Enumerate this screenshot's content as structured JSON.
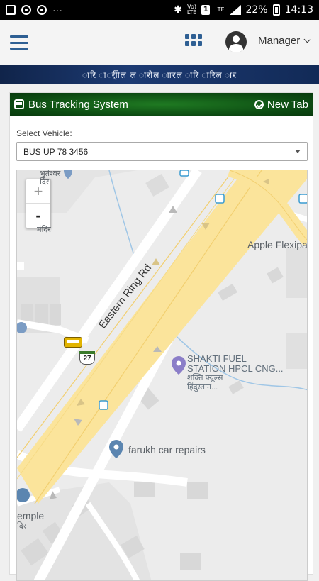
{
  "statusbar": {
    "icons_left": [
      "image-icon",
      "media-icon",
      "media-icon",
      "more-dots"
    ],
    "dots": "···",
    "network_top": "Vo)",
    "network_bottom": "LTE",
    "sim": "1",
    "lte2": "LTE",
    "battery": "22%",
    "time": "14:13"
  },
  "header": {
    "user_label": "Manager"
  },
  "banner": {
    "text": "ारि ार्ीोल ल ारोल ाारल ारि   ारिल ार"
  },
  "panel": {
    "title": "Bus Tracking System",
    "new_tab": "New Tab"
  },
  "vehicle": {
    "label": "Select Vehicle:",
    "selected": "BUS UP 78 3456"
  },
  "map": {
    "zoom_in": "+",
    "zoom_out": "-",
    "road": "Eastern Ring Rd",
    "route_number": "27",
    "places": {
      "temple_top_line1": "भुतेश्वर",
      "temple_top_line2": "दिर",
      "temple_top_line3": "मंदिर",
      "apple": "Apple Flexipa",
      "fuel_line1": "SHAKTI FUEL",
      "fuel_line2": "STATION HPCL CNG...",
      "fuel_line3": "शक्ति फ्यूल्स",
      "fuel_line4": "हिंदुस्तान...",
      "car_repairs": "farukh car repairs",
      "temple_bottom_line1": "emple",
      "temple_bottom_line2": "दिर"
    }
  },
  "colors": {
    "header_blue": "#2e5f93",
    "panel_green": "#0c4a12",
    "road_yellow": "#fbe49b",
    "poi_blue": "#5b85b0"
  }
}
